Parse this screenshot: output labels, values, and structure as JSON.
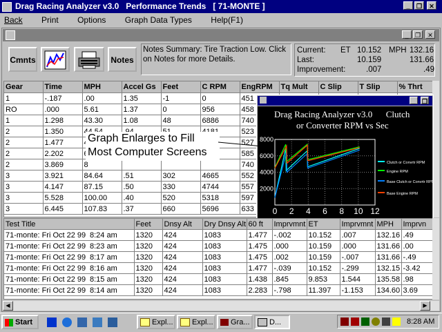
{
  "app": {
    "title": "Drag Racing Analyzer v3.0   Performance Trends   [ 71-MONTE ]",
    "menu": [
      "Back",
      "Print",
      "Options",
      "Graph Data Types",
      "Help(F1)"
    ]
  },
  "toolbar": {
    "cmnts_label": "Cmnts",
    "notes_label": "Notes",
    "notes_summary": "Notes Summary:  Tire Traction Low.  Click on Notes for more Details."
  },
  "summary": {
    "current_label": "Current:",
    "last_label": "Last:",
    "improvement_label": "Improvement:",
    "et_label": "ET",
    "mph_label": "MPH",
    "current_et": "10.152",
    "current_mph": "132.16",
    "last_et": "10.159",
    "last_mph": "131.66",
    "improvement_et": ".007",
    "improvement_mph": ".49"
  },
  "run_table": {
    "headers": [
      "Gear",
      "Time",
      "MPH",
      "Accel Gs",
      "Feet",
      "C RPM",
      "EngRPM",
      "Tq Mult",
      "C Slip",
      "T Slip",
      "% Thrt"
    ],
    "rows": [
      [
        "1",
        "-.187",
        ".00",
        "1.35",
        "-1",
        "0",
        "451"
      ],
      [
        "RO",
        ".000",
        "5.61",
        "1.37",
        "0",
        "956",
        "458"
      ],
      [
        "1",
        "1.298",
        "43.30",
        "1.08",
        "48",
        "6886",
        "740"
      ],
      [
        "2",
        "1.350",
        "44.54",
        ".94",
        "51",
        "4181",
        "523"
      ],
      [
        "2",
        "1.477",
        "4",
        "",
        "",
        "",
        "527"
      ],
      [
        "2",
        "2.202",
        "6",
        "",
        "",
        "",
        "585"
      ],
      [
        "2",
        "3.869",
        "8",
        "",
        "",
        "",
        "740"
      ],
      [
        "3",
        "3.921",
        "84.64",
        ".51",
        "302",
        "4665",
        "552"
      ],
      [
        "3",
        "4.147",
        "87.15",
        ".50",
        "330",
        "4744",
        "557"
      ],
      [
        "3",
        "5.528",
        "100.00",
        ".40",
        "520",
        "5318",
        "597"
      ],
      [
        "3",
        "6.445",
        "107.83",
        ".37",
        "660",
        "5696",
        "633"
      ]
    ]
  },
  "graph": {
    "title_line1": "Drag Racing Analyzer v3.0      Clutch",
    "title_line2": "or Converter RPM vs Sec",
    "callout_line1": "Graph Enlarges to Fill",
    "callout_line2": "Most Computer Screens",
    "legend": [
      "Clutch or Convrtr RPM",
      "Engine RPM",
      "Base Clutch or Convrtr RPM",
      "Base Engine RPM"
    ],
    "colors": {
      "clutch": "#00ffff",
      "engine": "#00ff00",
      "base_clutch": "#0080ff",
      "base_engine": "#ff4000"
    }
  },
  "chart_data": {
    "type": "line",
    "title": "Drag Racing Analyzer v3.0 Clutch or Converter RPM vs Sec",
    "xlim": [
      0,
      12
    ],
    "ylim": [
      0,
      8000
    ],
    "x_ticks": [
      "0",
      "2",
      "4",
      "6",
      "8",
      "10",
      "12"
    ],
    "y_ticks": [
      "0",
      "2000",
      "4000",
      "6000",
      "8000"
    ],
    "series": [
      {
        "name": "Clutch or Convrtr RPM",
        "x": [
          0,
          1.3,
          1.35,
          3.87,
          3.92,
          10.15
        ],
        "y": [
          950,
          6890,
          4180,
          6600,
          4660,
          6900
        ]
      },
      {
        "name": "Engine RPM",
        "x": [
          0,
          1.3,
          1.35,
          3.87,
          3.92,
          10.15
        ],
        "y": [
          4580,
          7400,
          5230,
          7400,
          5520,
          7100
        ]
      },
      {
        "name": "Base Clutch or Convrtr RPM",
        "x": [
          0,
          1.4,
          1.45,
          3.9,
          3.95,
          10.16
        ],
        "y": [
          900,
          6500,
          4000,
          6300,
          4500,
          6700
        ]
      },
      {
        "name": "Base Engine RPM",
        "x": [
          0,
          1.4,
          1.45,
          3.9,
          3.95,
          10.16
        ],
        "y": [
          4500,
          7200,
          5100,
          7300,
          5400,
          7000
        ]
      }
    ]
  },
  "tests_table": {
    "headers": [
      "Test Title",
      "Feet",
      "Dnsy Alt",
      "Dry Dnsy Alt",
      "60 ft",
      "Imprvmnt",
      "ET",
      "Imprvmnt",
      "MPH",
      "Imprvn"
    ],
    "rows": [
      [
        "71-monte: Fri Oct 22 99",
        "8:24 am",
        "1320",
        "424",
        "1083",
        "1.477",
        "-.002",
        "10.152",
        ".007",
        "132.16",
        ".49"
      ],
      [
        "71-monte: Fri Oct 22 99",
        "8:23 am",
        "1320",
        "424",
        "1083",
        "1.475",
        ".000",
        "10.159",
        ".000",
        "131.66",
        ".00"
      ],
      [
        "71-monte: Fri Oct 22 99",
        "8:17 am",
        "1320",
        "424",
        "1083",
        "1.475",
        ".002",
        "10.159",
        "-.007",
        "131.66",
        "-.49"
      ],
      [
        "71-monte: Fri Oct 22 99",
        "8:16 am",
        "1320",
        "424",
        "1083",
        "1.477",
        "-.039",
        "10.152",
        "-.299",
        "132.15",
        "-3.42"
      ],
      [
        "71-monte: Fri Oct 22 99",
        "8:15 am",
        "1320",
        "424",
        "1083",
        "1.438",
        ".845",
        "9.853",
        "1.544",
        "135.58",
        ".98"
      ],
      [
        "71-monte: Fri Oct 22 99",
        "8:14 am",
        "1320",
        "424",
        "1083",
        "2.283",
        "-.798",
        "11.397",
        "-1.153",
        "134.60",
        "3.69"
      ]
    ]
  },
  "taskbar": {
    "start_label": "Start",
    "tasks": [
      "Expl...",
      "Expl...",
      "Gra...",
      "D..."
    ],
    "clock": "8:28 AM"
  }
}
